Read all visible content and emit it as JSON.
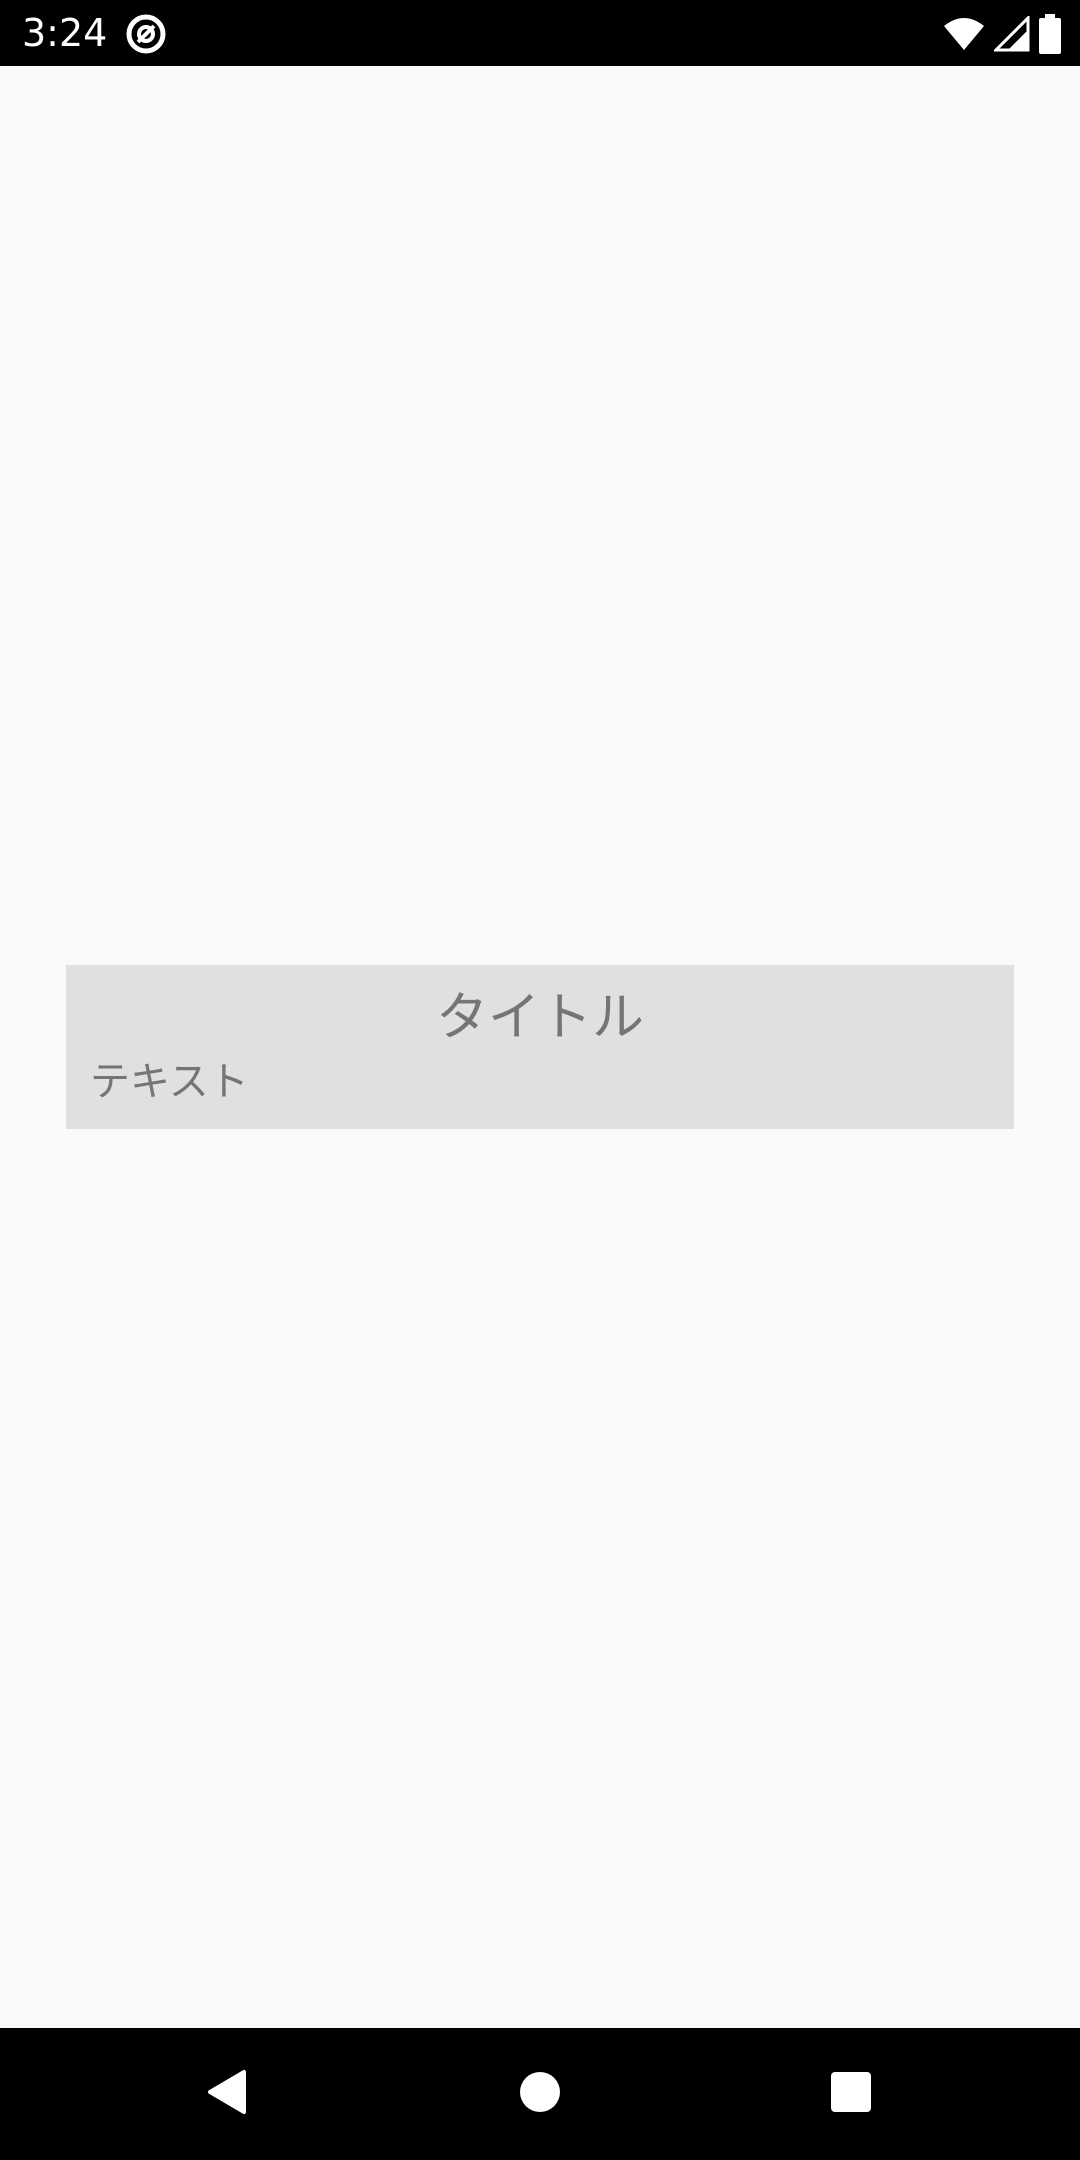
{
  "status_bar": {
    "time": "3:24",
    "app_icon": "at-sign-circle-icon",
    "icons": [
      "wifi-icon",
      "cell-signal-icon",
      "battery-icon"
    ]
  },
  "card": {
    "title": "タイトル",
    "text": "テキスト"
  },
  "nav_bar": {
    "buttons": [
      "back-icon",
      "home-icon",
      "recents-icon"
    ]
  },
  "colors": {
    "background": "#fafafa",
    "card_background": "#e0e0e0",
    "card_text": "#757575",
    "bars": "#000000"
  }
}
